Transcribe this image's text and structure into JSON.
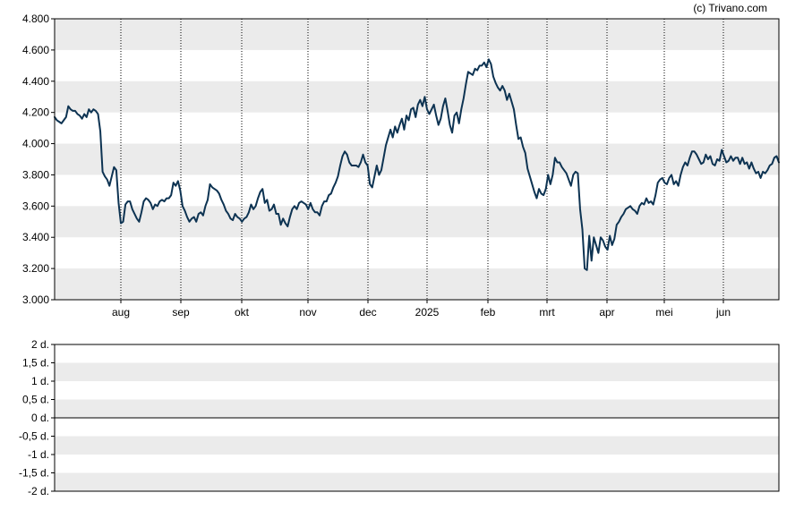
{
  "credit": "(c) Trivano.com",
  "colors": {
    "line": "#0d3352",
    "band": "#ebebeb",
    "grid": "#000000",
    "frame": "#000000"
  },
  "chart_data": [
    {
      "type": "line",
      "title": "",
      "xlabel": "",
      "ylabel": "",
      "ylim": [
        3.0,
        4.8
      ],
      "y_ticks": [
        "4.800",
        "4.600",
        "4.400",
        "4.200",
        "4.000",
        "3.800",
        "3.600",
        "3.400",
        "3.200",
        "3.000"
      ],
      "x_ticks": [
        "aug",
        "sep",
        "okt",
        "nov",
        "dec",
        "2025",
        "feb",
        "mrt",
        "apr",
        "mei",
        "jun"
      ],
      "grid": "vertical dotted lines at month ticks, alternating horizontal bands",
      "legend": "none",
      "series": [
        {
          "values": [
            4.17,
            4.15,
            4.14,
            4.13,
            4.15,
            4.17,
            4.24,
            4.22,
            4.21,
            4.21,
            4.19,
            4.18,
            4.16,
            4.19,
            4.17,
            4.22,
            4.2,
            4.22,
            4.21,
            4.19,
            4.08,
            3.82,
            3.79,
            3.77,
            3.73,
            3.79,
            3.85,
            3.83,
            3.62,
            3.49,
            3.5,
            3.61,
            3.63,
            3.63,
            3.58,
            3.55,
            3.52,
            3.5,
            3.56,
            3.63,
            3.65,
            3.64,
            3.62,
            3.58,
            3.61,
            3.6,
            3.63,
            3.64,
            3.63,
            3.65,
            3.65,
            3.67,
            3.75,
            3.73,
            3.76,
            3.7,
            3.6,
            3.57,
            3.53,
            3.5,
            3.52,
            3.53,
            3.5,
            3.55,
            3.56,
            3.54,
            3.6,
            3.64,
            3.74,
            3.72,
            3.71,
            3.7,
            3.68,
            3.64,
            3.61,
            3.57,
            3.55,
            3.52,
            3.51,
            3.55,
            3.53,
            3.52,
            3.5,
            3.52,
            3.53,
            3.56,
            3.61,
            3.58,
            3.6,
            3.65,
            3.69,
            3.71,
            3.62,
            3.64,
            3.57,
            3.58,
            3.61,
            3.55,
            3.55,
            3.48,
            3.52,
            3.49,
            3.47,
            3.53,
            3.58,
            3.6,
            3.58,
            3.62,
            3.63,
            3.62,
            3.61,
            3.58,
            3.62,
            3.58,
            3.56,
            3.56,
            3.54,
            3.6,
            3.63,
            3.63,
            3.67,
            3.68,
            3.72,
            3.75,
            3.79,
            3.86,
            3.92,
            3.95,
            3.93,
            3.88,
            3.86,
            3.86,
            3.86,
            3.85,
            3.88,
            3.93,
            3.88,
            3.86,
            3.74,
            3.72,
            3.79,
            3.86,
            3.8,
            3.83,
            3.91,
            3.99,
            4.04,
            4.09,
            4.04,
            4.11,
            4.07,
            4.12,
            4.16,
            4.09,
            4.18,
            4.15,
            4.22,
            4.23,
            4.17,
            4.25,
            4.28,
            4.24,
            4.3,
            4.22,
            4.19,
            4.22,
            4.25,
            4.18,
            4.12,
            4.16,
            4.24,
            4.29,
            4.21,
            4.12,
            4.07,
            4.18,
            4.2,
            4.13,
            4.22,
            4.29,
            4.38,
            4.46,
            4.45,
            4.44,
            4.48,
            4.47,
            4.5,
            4.5,
            4.52,
            4.49,
            4.54,
            4.51,
            4.43,
            4.39,
            4.36,
            4.34,
            4.37,
            4.34,
            4.28,
            4.32,
            4.27,
            4.22,
            4.12,
            4.03,
            4.04,
            3.98,
            3.94,
            3.84,
            3.79,
            3.74,
            3.69,
            3.65,
            3.71,
            3.68,
            3.67,
            3.71,
            3.8,
            3.74,
            3.8,
            3.91,
            3.88,
            3.88,
            3.85,
            3.83,
            3.81,
            3.77,
            3.73,
            3.8,
            3.82,
            3.81,
            3.58,
            3.45,
            3.2,
            3.19,
            3.41,
            3.25,
            3.4,
            3.35,
            3.3,
            3.4,
            3.38,
            3.34,
            3.32,
            3.41,
            3.35,
            3.39,
            3.48,
            3.5,
            3.53,
            3.55,
            3.58,
            3.59,
            3.6,
            3.58,
            3.57,
            3.55,
            3.6,
            3.62,
            3.61,
            3.65,
            3.62,
            3.63,
            3.61,
            3.67,
            3.75,
            3.77,
            3.78,
            3.75,
            3.74,
            3.78,
            3.8,
            3.74,
            3.76,
            3.73,
            3.8,
            3.85,
            3.88,
            3.86,
            3.91,
            3.95,
            3.95,
            3.93,
            3.9,
            3.87,
            3.88,
            3.93,
            3.9,
            3.92,
            3.87,
            3.86,
            3.9,
            3.89,
            3.96,
            3.92,
            3.88,
            3.89,
            3.92,
            3.89,
            3.91,
            3.91,
            3.87,
            3.91,
            3.87,
            3.88,
            3.84,
            3.88,
            3.84,
            3.81,
            3.82,
            3.78,
            3.82,
            3.81,
            3.83,
            3.86,
            3.87,
            3.91,
            3.92,
            3.88
          ]
        }
      ]
    },
    {
      "type": "line",
      "title": "",
      "xlabel": "",
      "ylabel": "",
      "ylim": [
        -2,
        2
      ],
      "y_ticks": [
        "2 d.",
        "1,5 d.",
        "1 d.",
        "0,5 d.",
        "0 d.",
        "-0,5 d.",
        "-1 d.",
        "-1,5 d.",
        "-2 d."
      ],
      "grid": "alternating horizontal bands, zero line",
      "legend": "none",
      "series": []
    }
  ]
}
